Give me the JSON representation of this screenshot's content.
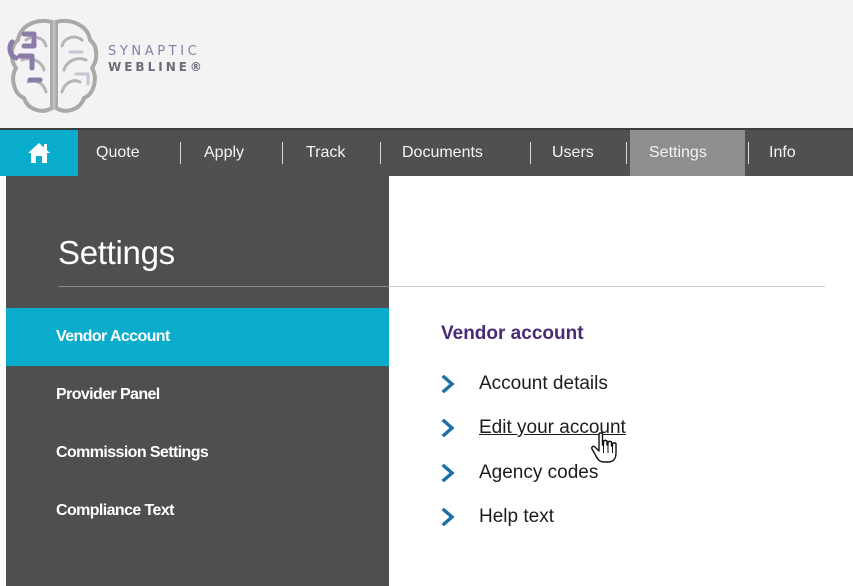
{
  "brand": {
    "line1": "SYNAPTIC",
    "line2": "WEBLINE®"
  },
  "nav": {
    "home_icon": "home-icon",
    "items": [
      "Quote",
      "Apply",
      "Track",
      "Documents",
      "Users",
      "Settings",
      "Info"
    ],
    "active": "Settings"
  },
  "sidebar": {
    "title": "Settings",
    "items": [
      "Vendor Account",
      "Provider Panel",
      "Commission Settings",
      "Compliance Text"
    ],
    "active": "Vendor Account"
  },
  "content": {
    "section_title": "Vendor account",
    "links": [
      "Account details",
      "Edit your account",
      "Agency codes",
      "Help text"
    ],
    "hovered": "Edit your account"
  },
  "colors": {
    "accent": "#0aaccc",
    "nav_bg": "#505050",
    "sidebar_bg": "#4f4f4f",
    "nav_active": "#8e8e8e",
    "section_title": "#4a2a75",
    "chevron": "#1a6fa8",
    "brain_logo": "#8a7ba8"
  }
}
